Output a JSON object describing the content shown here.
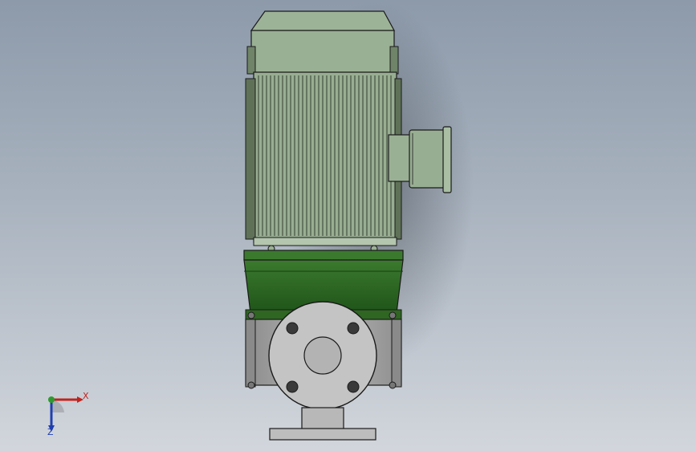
{
  "colors": {
    "background_top": "#8d9aaa",
    "background_bottom": "#d2d6dc",
    "motor_green": "#9bb094",
    "motor_green_dark": "#7f9678",
    "adapter_green": "#2f6a24",
    "pump_casing_grey": "#a6a6a6",
    "flange_grey": "#bdbdbd",
    "outline": "#1a1a1a",
    "axis_x": "#c0231f",
    "axis_y": "#2e9a2e",
    "axis_z": "#1f3fb0"
  },
  "triad": {
    "x_label": "X",
    "z_label": "Z"
  },
  "icons": {
    "triad": "coordinate-triad-icon"
  }
}
